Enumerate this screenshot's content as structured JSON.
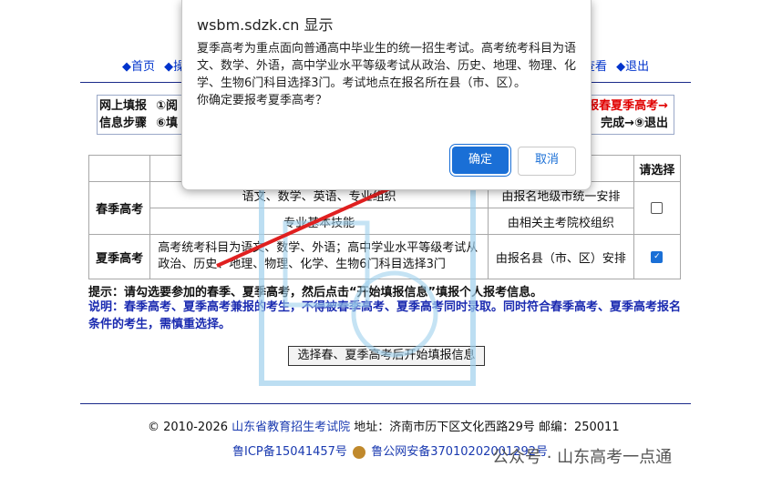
{
  "nav": {
    "home": "◆首页",
    "ops": "◆操作",
    "view": "查看",
    "logout": "◆退出"
  },
  "steps": {
    "row1_label": "网上填报",
    "row2_label": "信息步骤",
    "row1_mid": "①阅",
    "row2_mid": "⑥填",
    "row1_right": "报春夏季高考→",
    "row2_right": "完成→⑨退出"
  },
  "table": {
    "header_select": "请选择",
    "rows": [
      {
        "name": "春季高考",
        "subjects1": "语文、数学、英语、专业组织",
        "method1": "由报名地级市统一安排",
        "subjects2": "专业基本技能",
        "method2": "由相关主考院校组织",
        "checked": false
      },
      {
        "name": "夏季高考",
        "subjects": "高考统考科目为语文、数学、外语；高中学业水平等级考试从政治、历史、地理、物理、化学、生物6门科目选择3门",
        "method": "由报名县（市、区）安排",
        "checked": true
      }
    ]
  },
  "hint": "提示：请勾选要参加的春季、夏季高考，然后点击“开始填报信息”填报个人报考信息。",
  "note": "说明：春季高考、夏季高考兼报的考生，不得被春季高考、夏季高考同时录取。同时符合春季高考、夏季高考报名条件的考生，需慎重选择。",
  "start_button": "选择春、夏季高考后开始填报信息",
  "footer": {
    "copyright": "© 2010-2026",
    "org": "山东省教育招生考试院",
    "address": "地址：济南市历下区文化西路29号 邮编：250011",
    "icp": "鲁ICP备15041457号",
    "police": "鲁公网安备37010202001292号"
  },
  "wechat": "公众号 · 山东高考一点通",
  "dialog": {
    "title": "wsbm.sdzk.cn 显示",
    "message": "夏季高考为重点面向普通高中毕业生的统一招生考试。高考统考科目为语文、数学、外语，高中学业水平等级考试从政治、历史、地理、物理、化学、生物6门科目选择3门。考试地点在报名所在县（市、区）。",
    "question": "你确定要报考夏季高考？",
    "ok": "确定",
    "cancel": "取消"
  },
  "colors": {
    "accent": "#1a6fd6",
    "link": "#1a3ab0",
    "red": "#e00000"
  }
}
